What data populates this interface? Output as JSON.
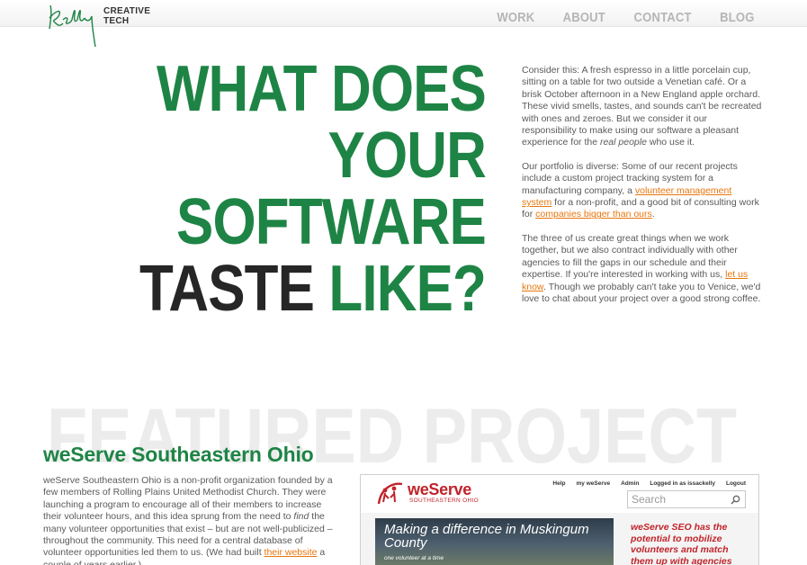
{
  "header": {
    "logo_line1": "CREATIVE",
    "logo_line2": "TECH",
    "nav": [
      "WORK",
      "ABOUT",
      "CONTACT",
      "BLOG"
    ]
  },
  "headline": {
    "lines": [
      "WHAT DOES",
      "YOUR",
      "SOFTWARE"
    ],
    "last_dark": "TASTE",
    "last_green": " LIKE?"
  },
  "intro": {
    "p1_a": "Consider this: A fresh espresso in a little porcelain cup, sitting on a table for two outside a Venetian café. Or a brisk October afternoon in a New England apple orchard. These vivid smells, tastes, and sounds can't be recreated with ones and zeroes. But we consider it our responsibility to make using our software a pleasant experience for the ",
    "p1_em": "real people",
    "p1_b": " who use it.",
    "p2_a": "Our portfolio is diverse: Some of our recent projects include a custom project tracking system for a manufacturing company, a ",
    "p2_link1": "volunteer management system",
    "p2_b": " for a non-profit, and a good bit of consulting work for ",
    "p2_link2": "companies bigger than ours",
    "p2_c": ".",
    "p3_a": "The three of us create great things when we work together, but we also contract individually with other agencies to fill the gaps in our schedule and their expertise. If you're interested in working with us, ",
    "p3_link": "let us know",
    "p3_b": ". Though we probably can't take you to Venice, we'd love to chat about your project over a good strong coffee."
  },
  "featured": {
    "bg_heading": "FEATURED PROJECT",
    "title": "weServe Southeastern Ohio",
    "desc_a": "weServe Southeastern Ohio is a non-profit organization founded by a few members of Rolling Plains United Methodist Church. They were launching a program to encourage all of their members to increase their volunteer hours, and this idea sprung from the need to ",
    "desc_em": "find",
    "desc_b": " the many volunteer opportunities that exist – but are not well-publicized – throughout the community. This need for a central database of volunteer opportunities led them to us. (We had built ",
    "desc_link": "their website",
    "desc_c": " a couple of years earlier.)"
  },
  "screenshot": {
    "brand": "weServe",
    "brand_sub": "SOUTHEASTERN OHIO",
    "links": [
      "Help",
      "my weServe",
      "Admin",
      "Logged in as issackelly",
      "Logout"
    ],
    "search_placeholder": "Search",
    "hero_title": "Making a difference in Muskingum County",
    "hero_sub": "one volunteer at a time",
    "side_text": "weServe SEO has the potential to mobilize volunteers and match them up with agencies who need"
  },
  "colors": {
    "green": "#1e8445",
    "dark": "#262626",
    "link_orange": "#e8760f",
    "nav_gray": "#b5b5b5",
    "weserve_red": "#c0242a"
  }
}
